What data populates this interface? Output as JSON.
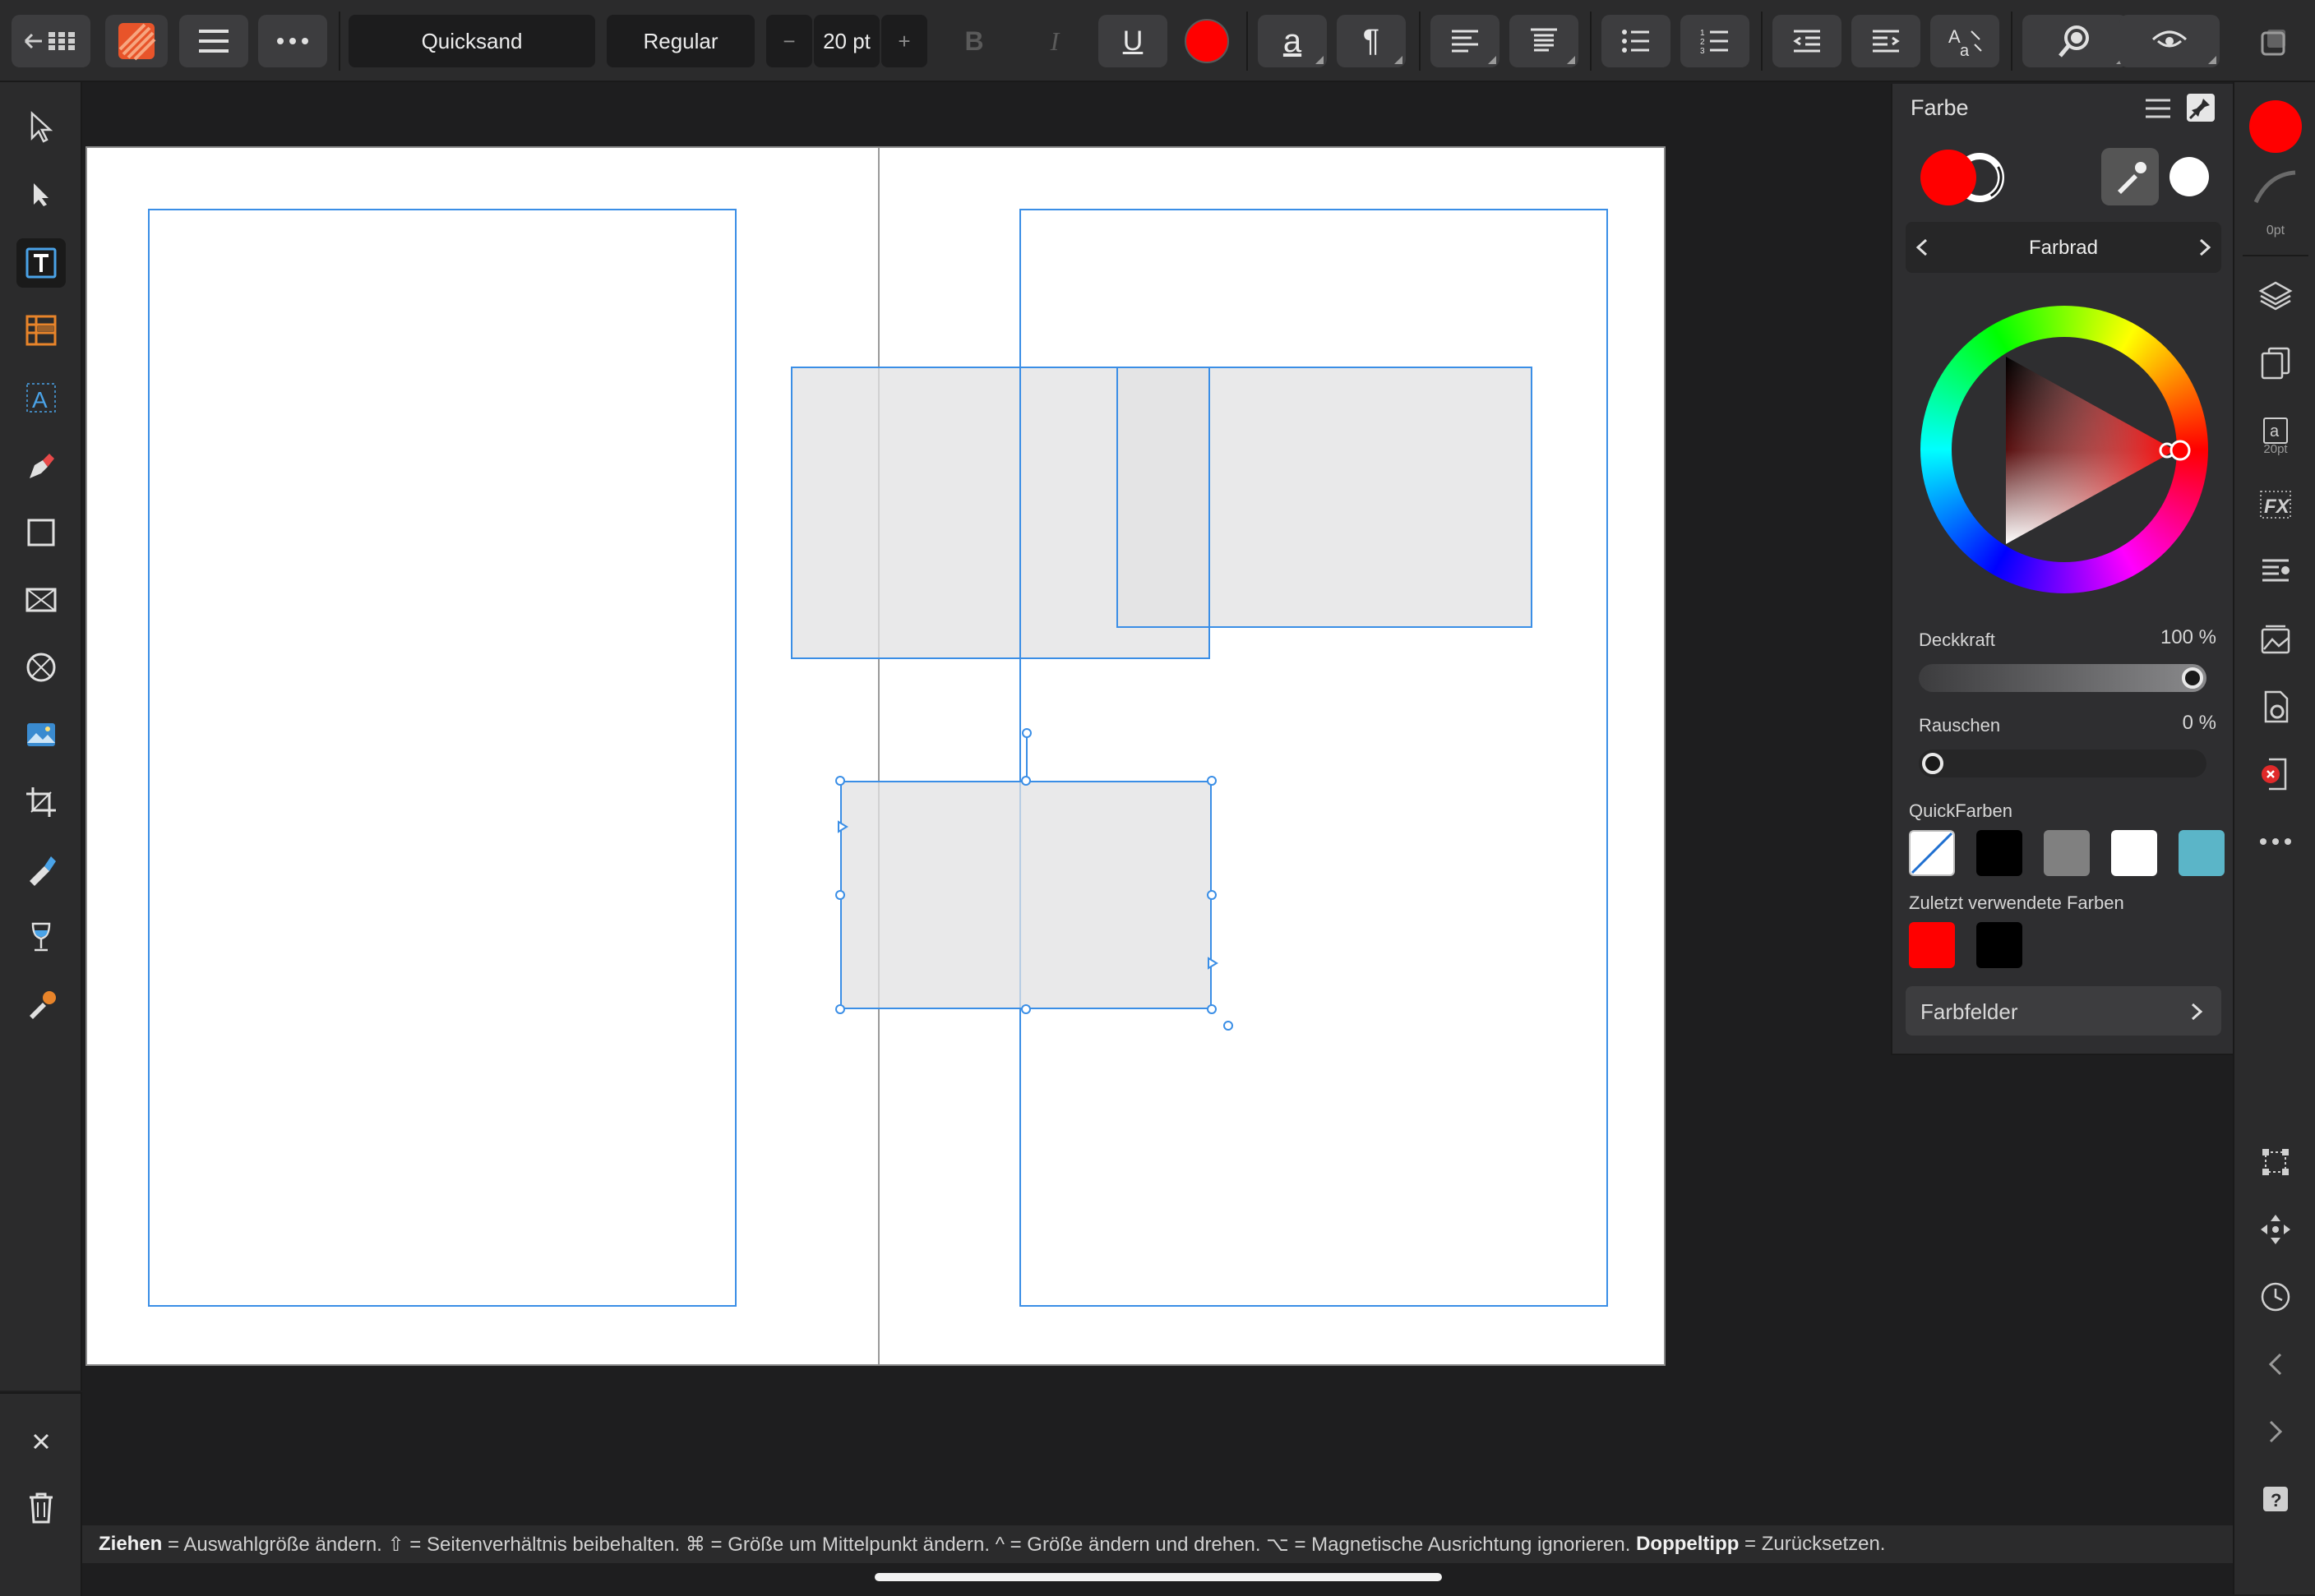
{
  "toolbar": {
    "font_name": "Quicksand",
    "font_style": "Regular",
    "font_size": "20 pt",
    "minus": "−",
    "plus": "+",
    "bold": "B",
    "italic": "I",
    "underline": "U",
    "text_color": "#ff0000",
    "char_label": "a",
    "para_label": "¶"
  },
  "panel": {
    "title": "Farbe",
    "mode": "Farbrad",
    "opacity_label": "Deckkraft",
    "opacity_value": "100 %",
    "opacity": 1.0,
    "noise_label": "Rauschen",
    "noise_value": "0 %",
    "noise": 0.0,
    "fill_color": "#ff0000",
    "quick_title": "QuickFarben",
    "quick_colors": [
      "none",
      "#000000",
      "#808080",
      "#ffffff",
      "#5bb5c8"
    ],
    "recent_title": "Zuletzt verwendete Farben",
    "recent_colors": [
      "#ff0000",
      "#000000"
    ],
    "swatches_label": "Farbfelder"
  },
  "right": {
    "stroke_width": "0pt",
    "text_size_badge": "20pt",
    "fx_label": "FX"
  },
  "status": {
    "part1_bold": "Ziehen",
    "part1": " = Auswahlgröße ändern. ⇧ = Seitenverhältnis beibehalten. ⌘ = Größe um Mittelpunkt ändern. ^ = Größe ändern und drehen. ⌥ = Magnetische Ausrichtung ignorieren. ",
    "part2_bold": "Doppeltipp",
    "part2": " = Zurücksetzen."
  }
}
